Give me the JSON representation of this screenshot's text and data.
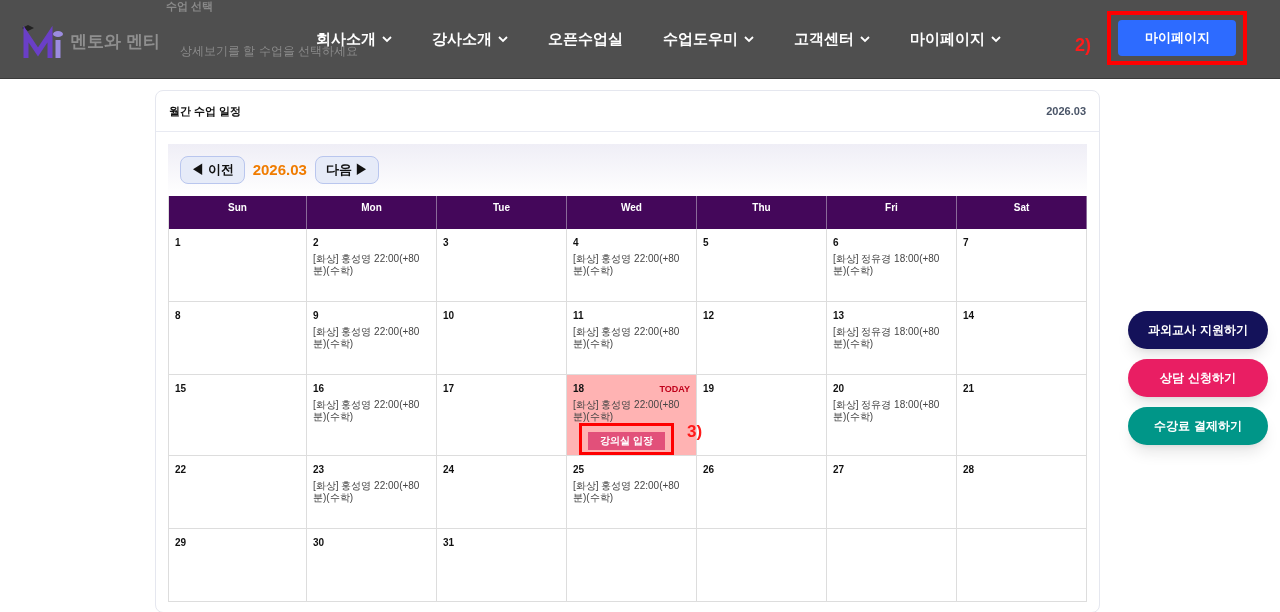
{
  "background_section": {
    "title": "수업 선택",
    "hint": "상세보기를 할 수업을 선택하세요"
  },
  "header": {
    "logo_text": "멘토와 멘티",
    "nav": [
      {
        "label": "회사소개",
        "has_dropdown": true
      },
      {
        "label": "강사소개",
        "has_dropdown": true
      },
      {
        "label": "오픈수업실",
        "has_dropdown": false
      },
      {
        "label": "수업도우미",
        "has_dropdown": true
      },
      {
        "label": "고객센터",
        "has_dropdown": true
      },
      {
        "label": "마이페이지",
        "has_dropdown": true
      }
    ],
    "annotation": "2)",
    "button": "마이페이지"
  },
  "calendar": {
    "title": "월간 수업 일정",
    "period": "2026.03",
    "prev": "◀ 이전",
    "month": "2026.03",
    "next": "다음 ▶",
    "weekdays": [
      "Sun",
      "Mon",
      "Tue",
      "Wed",
      "Thu",
      "Fri",
      "Sat"
    ],
    "weeks": [
      [
        {
          "day": "1"
        },
        {
          "day": "2",
          "events": [
            "[화상] 홍성영 22:00(+80분)(수학)"
          ]
        },
        {
          "day": "3"
        },
        {
          "day": "4",
          "events": [
            "[화상] 홍성영 22:00(+80분)(수학)"
          ]
        },
        {
          "day": "5"
        },
        {
          "day": "6",
          "events": [
            "[화상] 정유경 18:00(+80분)(수학)"
          ]
        },
        {
          "day": "7"
        }
      ],
      [
        {
          "day": "8"
        },
        {
          "day": "9",
          "events": [
            "[화상] 홍성영 22:00(+80분)(수학)"
          ]
        },
        {
          "day": "10"
        },
        {
          "day": "11",
          "events": [
            "[화상] 홍성영 22:00(+80분)(수학)"
          ]
        },
        {
          "day": "12"
        },
        {
          "day": "13",
          "events": [
            "[화상] 정유경 18:00(+80분)(수학)"
          ]
        },
        {
          "day": "14"
        }
      ],
      [
        {
          "day": "15"
        },
        {
          "day": "16",
          "events": [
            "[화상] 홍성영 22:00(+80분)(수학)"
          ]
        },
        {
          "day": "17"
        },
        {
          "day": "18",
          "today": true,
          "today_label": "TODAY",
          "events": [
            "[화상] 홍성영 22:00(+80분)(수학)"
          ],
          "enter_button": "강의실 입장",
          "annotation": "3)"
        },
        {
          "day": "19"
        },
        {
          "day": "20",
          "events": [
            "[화상] 정유경 18:00(+80분)(수학)"
          ]
        },
        {
          "day": "21"
        }
      ],
      [
        {
          "day": "22"
        },
        {
          "day": "23",
          "events": [
            "[화상] 홍성영 22:00(+80분)(수학)"
          ]
        },
        {
          "day": "24"
        },
        {
          "day": "25",
          "events": [
            "[화상] 홍성영 22:00(+80분)(수학)"
          ]
        },
        {
          "day": "26"
        },
        {
          "day": "27"
        },
        {
          "day": "28"
        }
      ],
      [
        {
          "day": "29"
        },
        {
          "day": "30"
        },
        {
          "day": "31"
        }
      ]
    ]
  },
  "side_buttons": [
    {
      "label": "과외교사 지원하기",
      "color": "#14125a"
    },
    {
      "label": "상담 신청하기",
      "color": "#e91e63"
    },
    {
      "label": "수강료 결제하기",
      "color": "#009688"
    }
  ]
}
